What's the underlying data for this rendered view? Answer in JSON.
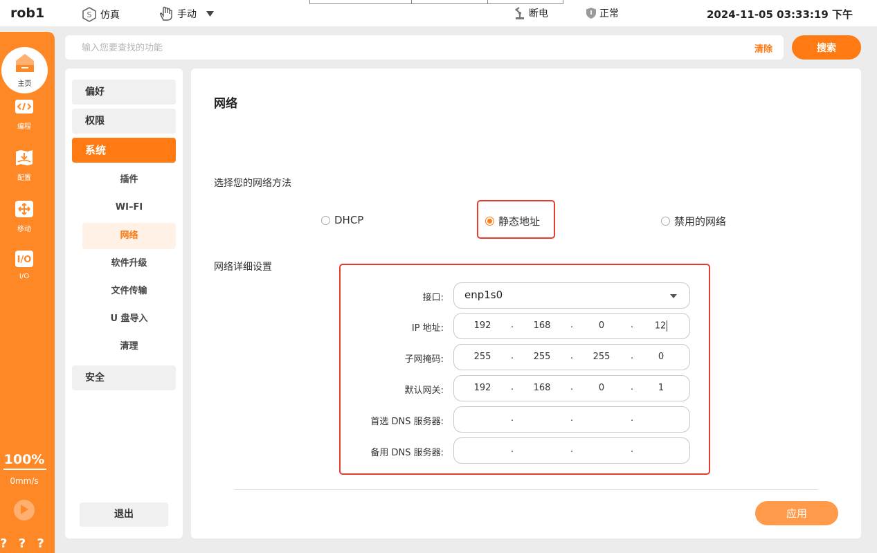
{
  "topbar": {
    "robot_name": "rob1",
    "mode_sim": "仿真",
    "mode_manual": "手动",
    "power_status": "断电",
    "safety_status": "正常",
    "datetime": "2024-11-05 03:33:19 下午"
  },
  "sidebar": {
    "home": "主页",
    "items": [
      {
        "label": "编程",
        "icon": "code-icon"
      },
      {
        "label": "配置",
        "icon": "config-download-icon"
      },
      {
        "label": "移动",
        "icon": "move-arrows-icon"
      },
      {
        "label": "I/O",
        "icon": "io-icon"
      }
    ],
    "speed_percent": "100%",
    "speed_value": "0mm/s",
    "help": "? ? ? ?"
  },
  "search": {
    "placeholder": "输入您要查找的功能",
    "clear_label": "清除",
    "button_label": "搜索"
  },
  "nav": {
    "categories": [
      "偏好",
      "权限",
      "系统",
      "安全"
    ],
    "system_items": [
      "插件",
      "WI–FI",
      "网络",
      "软件升级",
      "文件传输",
      "U 盘导入",
      "清理"
    ],
    "logout_label": "退出"
  },
  "network": {
    "title": "网络",
    "method_label": "选择您的网络方法",
    "options": [
      "DHCP",
      "静态地址",
      "禁用的网络"
    ],
    "selected_option": "静态地址",
    "details_label": "网络详细设置",
    "interface_label": "接口:",
    "interface_value": "enp1s0",
    "fields": [
      {
        "label": "IP 地址:",
        "octets": [
          "192",
          "168",
          "0",
          "12"
        ]
      },
      {
        "label": "子网掩码:",
        "octets": [
          "255",
          "255",
          "255",
          "0"
        ]
      },
      {
        "label": "默认网关:",
        "octets": [
          "192",
          "168",
          "0",
          "1"
        ]
      },
      {
        "label": "首选 DNS 服务器:",
        "octets": [
          "",
          "",
          "",
          ""
        ]
      },
      {
        "label": "备用 DNS 服务器:",
        "octets": [
          "",
          "",
          "",
          ""
        ]
      }
    ],
    "separator": ".",
    "apply_label": "应用"
  },
  "colors": {
    "accent": "#ff7a12",
    "sidebar": "#ff8826",
    "highlight": "#e53c2e"
  }
}
